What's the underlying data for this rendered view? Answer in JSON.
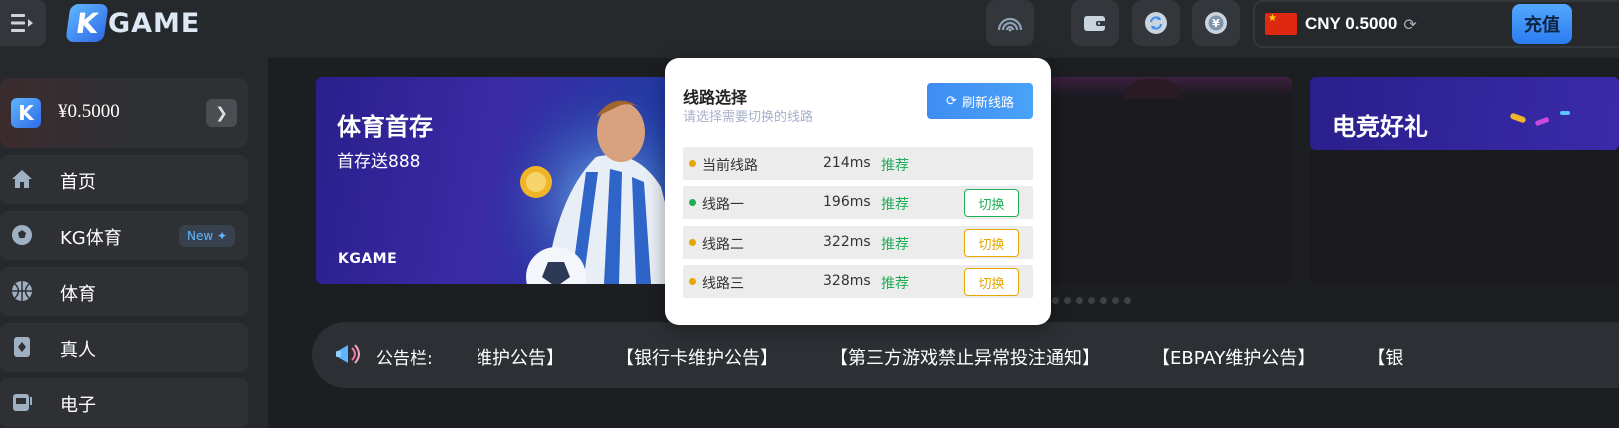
{
  "header": {
    "logo_text": "GAME",
    "logo_letter": "K",
    "currency_label": "CNY 0.5000",
    "recharge_label": "充值",
    "icons": [
      "menu-icon",
      "signal-icon",
      "wallet-icon",
      "refresh-icon",
      "yuan-icon",
      "china-flag-icon",
      "refresh-small-icon"
    ]
  },
  "sidebar": {
    "balance": "¥0.5000",
    "items": [
      {
        "label": "首页",
        "icon": "home-icon"
      },
      {
        "label": "KG体育",
        "icon": "soccer-icon",
        "badge": "New ✦"
      },
      {
        "label": "体育",
        "icon": "basketball-icon"
      },
      {
        "label": "真人",
        "icon": "card-icon"
      },
      {
        "label": "电子",
        "icon": "slot-icon"
      }
    ]
  },
  "banners": {
    "sports_title": "体育首存",
    "sports_sub": "首存送888",
    "sports_brand": "KGAME",
    "esports_title": "电竞好礼"
  },
  "notice": {
    "label": "公告栏:",
    "items": [
      "行维护公告】",
      "【银行卡维护公告】",
      "【第三方游戏禁止异常投注通知】",
      "【EBPAY维护公告】",
      "【银"
    ]
  },
  "route_popup": {
    "title": "线路选择",
    "subtitle": "请选择需要切换的线路",
    "refresh_label": "刷新线路",
    "routes": [
      {
        "name": "当前线路",
        "latency": "214ms",
        "tag": "推荐",
        "dot_color": "#e6a700",
        "switch": ""
      },
      {
        "name": "线路一",
        "latency": "196ms",
        "tag": "推荐",
        "dot_color": "#1fae57",
        "switch": "切换",
        "switch_color": "#1fae57"
      },
      {
        "name": "线路二",
        "latency": "322ms",
        "tag": "推荐",
        "dot_color": "#e6a700",
        "switch": "切换",
        "switch_color": "#e6a700"
      },
      {
        "name": "线路三",
        "latency": "328ms",
        "tag": "推荐",
        "dot_color": "#e6a700",
        "switch": "切换",
        "switch_color": "#e6a700"
      }
    ]
  },
  "colors": {
    "accent_blue": "#3f8cf2",
    "green": "#1fae57",
    "amber": "#e6a700",
    "bg": "#1c1e21",
    "panel": "#26292c"
  }
}
